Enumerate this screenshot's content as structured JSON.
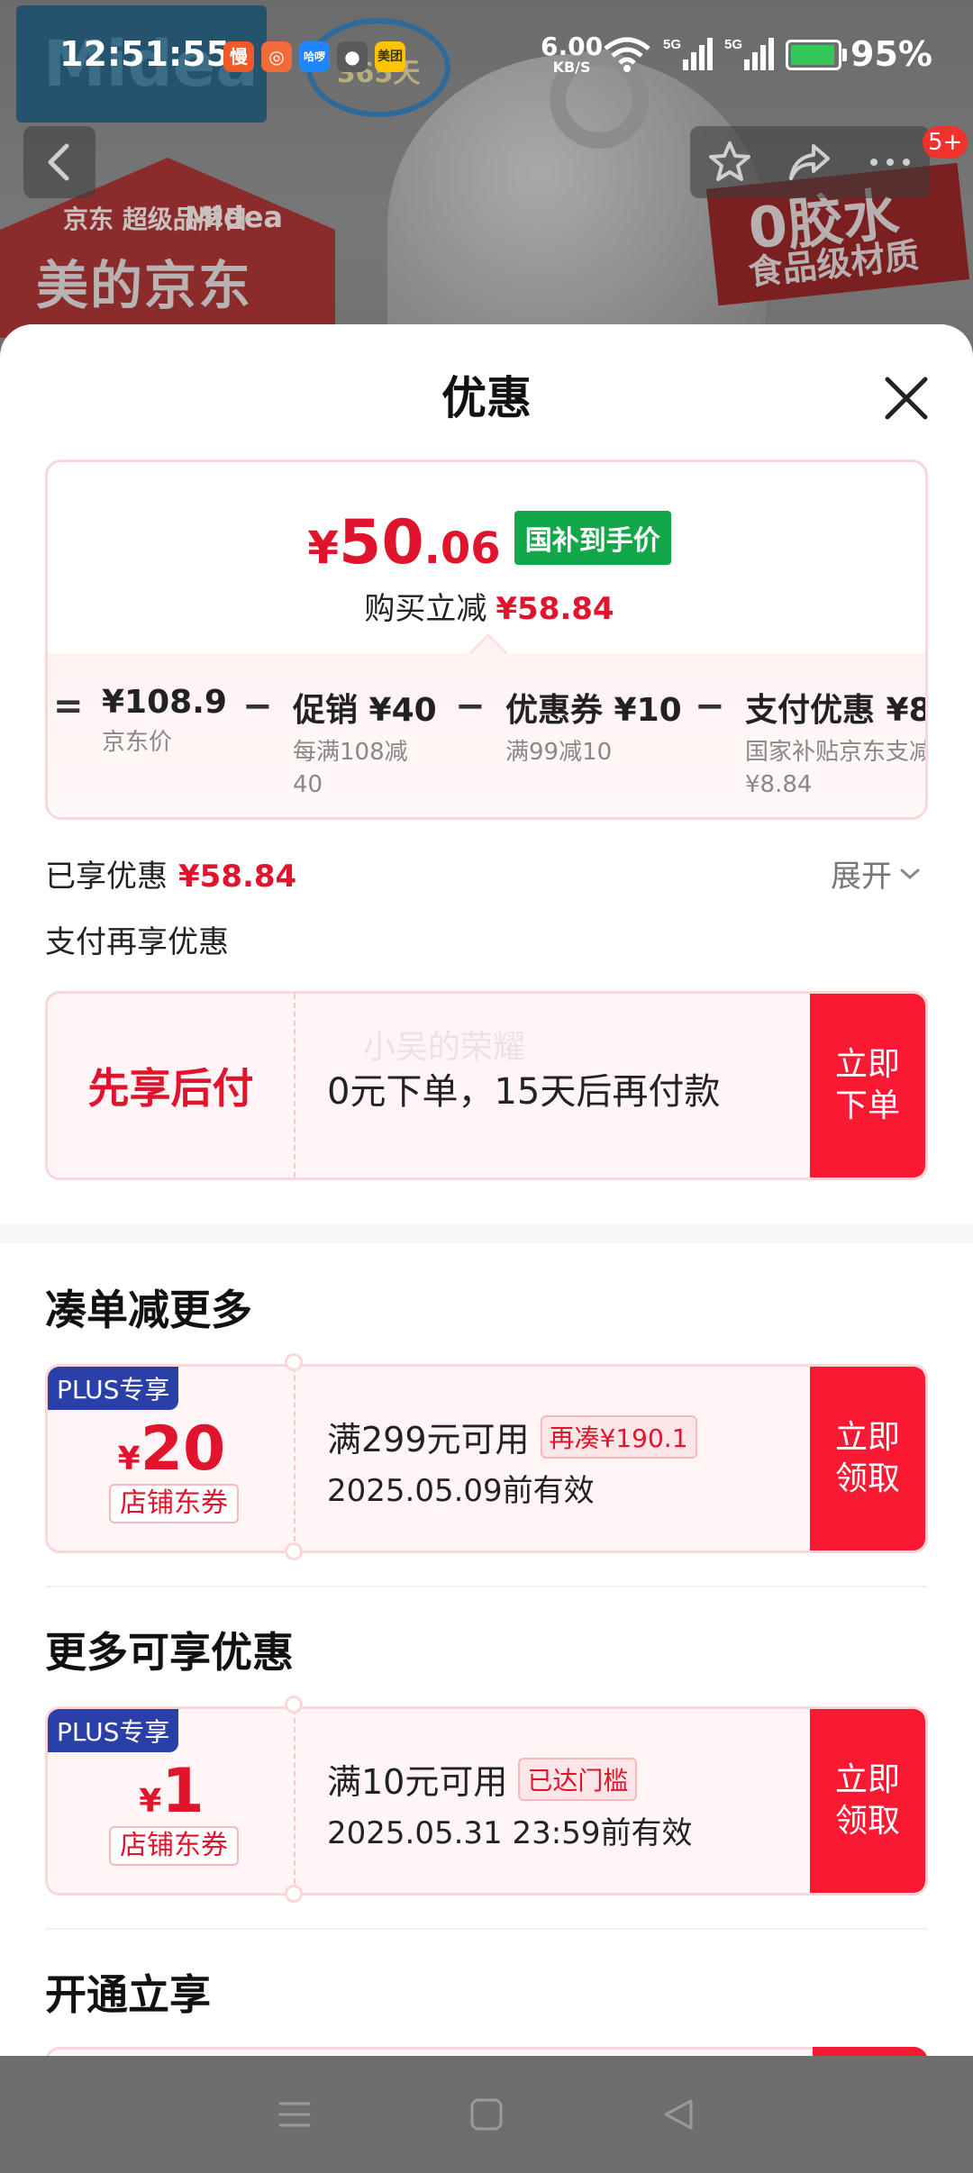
{
  "status_bar": {
    "time": "12:51:55",
    "app_icons": [
      "慢",
      "哈啰",
      "美团"
    ],
    "net_speed_value": "6.00",
    "net_speed_unit": "KB/S",
    "signal_1": "5G",
    "signal_2": "5G",
    "battery_pct": "95%",
    "battery_level": 0.95
  },
  "background": {
    "brand_top": "Midea",
    "badge_text": "365天",
    "banner_sub": "京东 超级品牌日",
    "banner_brand": "Midea",
    "banner_title": "美的京东",
    "slogan_main": "0胶水",
    "slogan_sub": "食品级材质",
    "message_badge": "5+"
  },
  "sheet": {
    "title": "优惠",
    "final_price": {
      "currency": "¥",
      "integer": "50",
      "decimal": ".06"
    },
    "final_price_tag": "国补到手价",
    "subsidy_label": "购买立减",
    "subsidy_amount": "¥58.84",
    "breakdown": [
      {
        "op": "="
      },
      {
        "value": "¥108.9",
        "desc": "京东价"
      },
      {
        "op": "−"
      },
      {
        "value": "促销 ¥40",
        "desc": "每满108减40"
      },
      {
        "op": "−"
      },
      {
        "value": "优惠券 ¥10",
        "desc": "满99减10"
      },
      {
        "op": "−"
      },
      {
        "value": "支付优惠 ¥8",
        "desc": "国家补贴京东支减¥8.84"
      }
    ],
    "enjoyed_label": "已享优惠",
    "enjoyed_amount": "¥58.84",
    "expand_label": "展开",
    "pay_more_label": "支付再享优惠",
    "bnpl": {
      "title": "先享后付",
      "desc": "0元下单，15天后再付款",
      "watermark": "小吴的荣耀",
      "cta": "立即下单"
    },
    "section_bundle": "凑单减更多",
    "section_more": "更多可享优惠",
    "section_open": "开通立享",
    "coupons": [
      {
        "tag": "PLUS专享",
        "currency": "¥",
        "amount": "20",
        "type": "店铺东券",
        "condition": "满299元可用",
        "condition_tag": "再凑¥190.1",
        "validity": "2025.05.09前有效",
        "cta": "立即领取"
      },
      {
        "tag": "PLUS专享",
        "currency": "¥",
        "amount": "1",
        "type": "店铺东券",
        "condition": "满10元可用",
        "condition_tag": "已达门槛",
        "validity": "2025.05.31 23:59前有效",
        "cta": "立即领取"
      }
    ]
  },
  "colors": {
    "accent_red": "#e0142d",
    "cta_red": "#fa1932",
    "tag_green": "#11a84a",
    "plus_blue": "#2b3fa8"
  }
}
